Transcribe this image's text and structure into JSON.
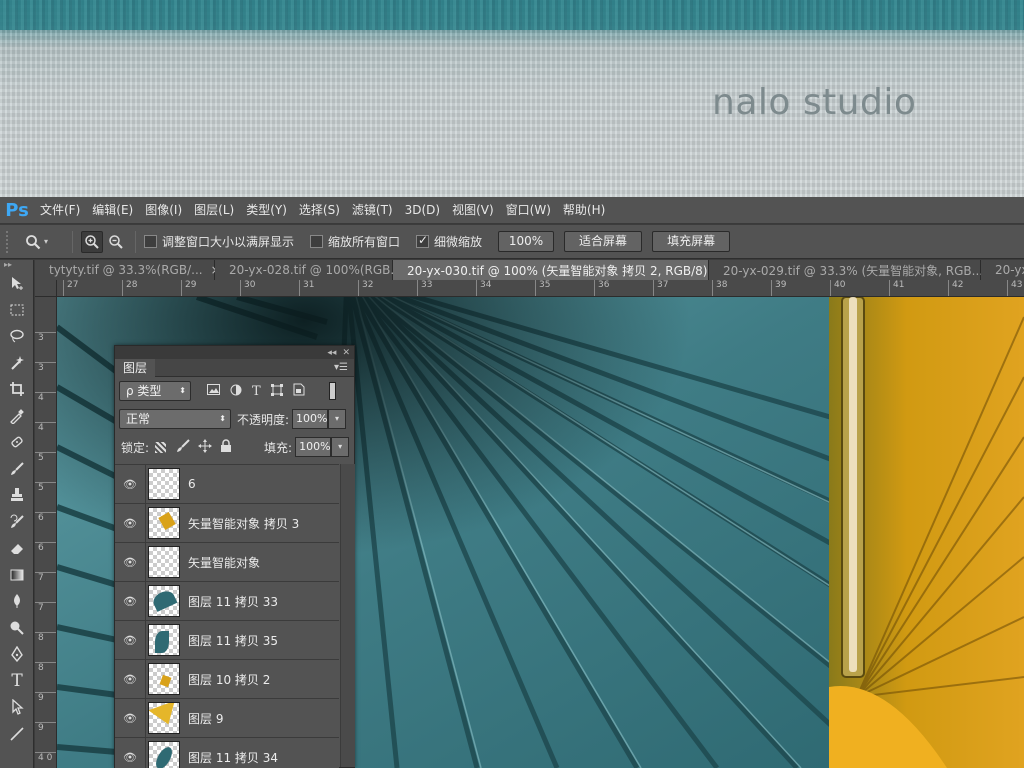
{
  "banner": {
    "brand_text": "nalo studio"
  },
  "menubar": {
    "logo": "Ps",
    "items": [
      "文件(F)",
      "编辑(E)",
      "图像(I)",
      "图层(L)",
      "类型(Y)",
      "选择(S)",
      "滤镜(T)",
      "3D(D)",
      "视图(V)",
      "窗口(W)",
      "帮助(H)"
    ]
  },
  "options": {
    "resize_windows": {
      "label": "调整窗口大小以满屏显示",
      "checked": false
    },
    "zoom_all": {
      "label": "缩放所有窗口",
      "checked": false
    },
    "scrubby_zoom": {
      "label": "细微缩放",
      "checked": true
    },
    "btn_100": "100%",
    "btn_fit": "适合屏幕",
    "btn_fill": "填充屏幕"
  },
  "tabs": [
    {
      "label": "tytyty.tif @ 33.3%(RGB/...",
      "active": false
    },
    {
      "label": "20-yx-028.tif @ 100%(RGB...",
      "active": false
    },
    {
      "label": "20-yx-030.tif @ 100% (矢量智能对象 拷贝 2, RGB/8)",
      "active": true
    },
    {
      "label": "20-yx-029.tif @ 33.3% (矢量智能对象, RGB...",
      "active": false
    },
    {
      "label": "20-yx",
      "active": false
    }
  ],
  "ruler_h": [
    "27",
    "28",
    "29",
    "30",
    "31",
    "32",
    "33",
    "34",
    "35",
    "36",
    "37",
    "38",
    "39",
    "40",
    "41",
    "42",
    "43"
  ],
  "ruler_v": [
    "3",
    "3",
    "4",
    "4",
    "5",
    "5",
    "6",
    "6",
    "7",
    "7",
    "8",
    "8",
    "9",
    "9",
    "4 0"
  ],
  "layers_panel": {
    "title": "图层",
    "filter_label": "ρ 类型",
    "blend_mode": "正常",
    "opacity_label": "不透明度:",
    "opacity_value": "100%",
    "lock_label": "锁定:",
    "fill_label": "填充:",
    "fill_value": "100%",
    "layers": [
      {
        "name": "6",
        "thumb": "blank"
      },
      {
        "name": "矢量智能对象 拷贝 3",
        "thumb": "gold"
      },
      {
        "name": "矢量智能对象",
        "thumb": "blank"
      },
      {
        "name": "图层 11 拷贝 33",
        "thumb": "teal"
      },
      {
        "name": "图层 11 拷贝 35",
        "thumb": "teal"
      },
      {
        "name": "图层 10 拷贝 2",
        "thumb": "gold"
      },
      {
        "name": "图层 9",
        "thumb": "gold"
      },
      {
        "name": "图层 11 拷贝 34",
        "thumb": "teal"
      }
    ]
  },
  "colors": {
    "accent_ps": "#3ea8f5",
    "canvas_teal": "#4f8a92",
    "canvas_gold": "#d9a21a"
  }
}
